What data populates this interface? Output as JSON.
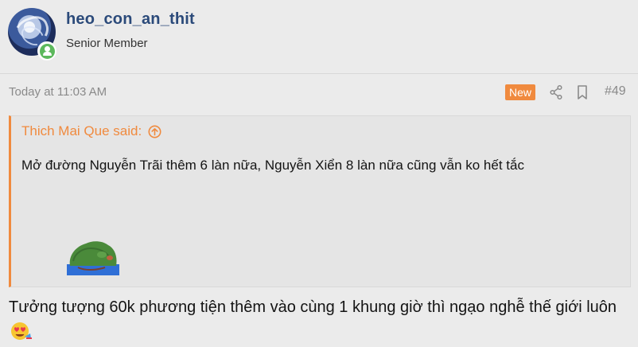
{
  "user": {
    "username": "heo_con_an_thit",
    "title": "Senior Member"
  },
  "post": {
    "date": "Today at 11:03 AM",
    "new_badge": "New",
    "number": "#49"
  },
  "quote": {
    "author_said": "Thich Mai Que said:",
    "text": "Mở đường Nguyễn Trãi thêm 6 làn nữa, Nguyễn Xiển 8 làn nữa cũng vẫn ko hết tắc",
    "sticker": "pepe-frog-sticker"
  },
  "reply": {
    "text": "Tưởng tượng 60k phương tiện thêm vào cùng 1 khung giờ thì ngạo nghễ thế giới luôn",
    "emoji": "smiling-face-with-heart-eyes-icon"
  },
  "colors": {
    "accent": "#f08a3e",
    "username": "#2b4a7a",
    "online": "#5cb85c",
    "muted": "#8a8a8a"
  }
}
